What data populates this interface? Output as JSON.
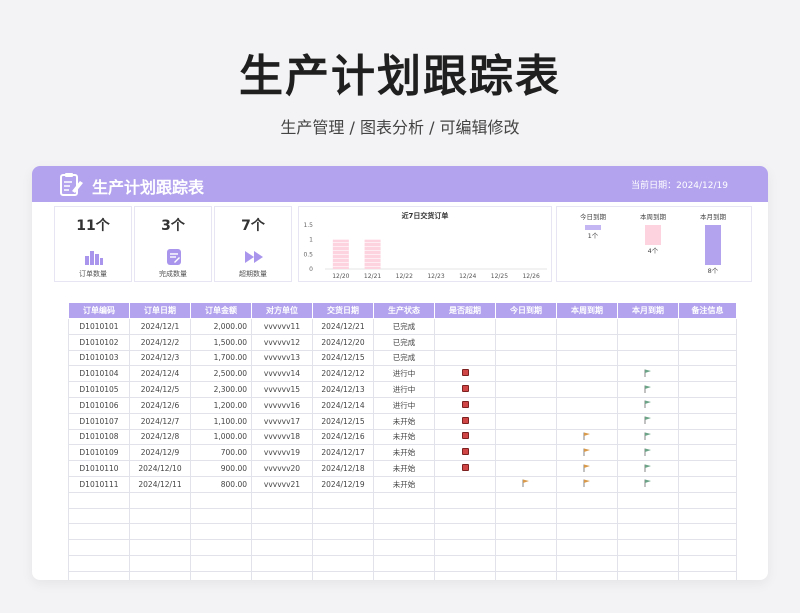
{
  "page": {
    "title": "生产计划跟踪表",
    "subtitle": "生产管理 / 图表分析 / 可编辑修改"
  },
  "header": {
    "title": "生产计划跟踪表",
    "date_label": "当前日期：",
    "date_value": "2024/12/19",
    "color": "#b3a3ee"
  },
  "stats": [
    {
      "value": "11个",
      "label": "订单数量",
      "icon": "bar-chart-icon"
    },
    {
      "value": "3个",
      "label": "完成数量",
      "icon": "document-edit-icon"
    },
    {
      "value": "7个",
      "label": "超期数量",
      "icon": "fast-forward-icon"
    }
  ],
  "chart_data": [
    {
      "type": "bar",
      "title": "近7日交货订单",
      "categories": [
        "12/20",
        "12/21",
        "12/22",
        "12/23",
        "12/24",
        "12/25",
        "12/26"
      ],
      "values": [
        1,
        1,
        0,
        0,
        0,
        0,
        0
      ],
      "ylim": [
        0,
        1.5
      ],
      "yticks": [
        "0",
        "0.5",
        "1",
        "1.5"
      ],
      "color": "#fcd3df"
    },
    {
      "type": "bar",
      "categories": [
        "今日到期",
        "本周到期",
        "本月到期"
      ],
      "values": [
        1,
        4,
        8
      ],
      "data_labels": [
        "1个",
        "4个",
        "8个"
      ],
      "colors": [
        "#c4b6f3",
        "#fcd3df",
        "#b3a3ee"
      ]
    }
  ],
  "table": {
    "headers": [
      "订单编码",
      "订单日期",
      "订单金额",
      "对方单位",
      "交货日期",
      "生产状态",
      "是否超期",
      "今日到期",
      "本周到期",
      "本月到期",
      "备注信息"
    ],
    "rows": [
      {
        "code": "D1010101",
        "date": "2024/12/1",
        "amount": "2,000.00",
        "unit": "vvvvvv11",
        "delivery": "2024/12/21",
        "status": "已完成",
        "overdue": false,
        "today": false,
        "week": false,
        "month": false
      },
      {
        "code": "D1010102",
        "date": "2024/12/2",
        "amount": "1,500.00",
        "unit": "vvvvvv12",
        "delivery": "2024/12/20",
        "status": "已完成",
        "overdue": false,
        "today": false,
        "week": false,
        "month": false
      },
      {
        "code": "D1010103",
        "date": "2024/12/3",
        "amount": "1,700.00",
        "unit": "vvvvvv13",
        "delivery": "2024/12/15",
        "status": "已完成",
        "overdue": false,
        "today": false,
        "week": false,
        "month": false
      },
      {
        "code": "D1010104",
        "date": "2024/12/4",
        "amount": "2,500.00",
        "unit": "vvvvvv14",
        "delivery": "2024/12/12",
        "status": "进行中",
        "overdue": true,
        "today": false,
        "week": false,
        "month": true
      },
      {
        "code": "D1010105",
        "date": "2024/12/5",
        "amount": "2,300.00",
        "unit": "vvvvvv15",
        "delivery": "2024/12/13",
        "status": "进行中",
        "overdue": true,
        "today": false,
        "week": false,
        "month": true
      },
      {
        "code": "D1010106",
        "date": "2024/12/6",
        "amount": "1,200.00",
        "unit": "vvvvvv16",
        "delivery": "2024/12/14",
        "status": "进行中",
        "overdue": true,
        "today": false,
        "week": false,
        "month": true
      },
      {
        "code": "D1010107",
        "date": "2024/12/7",
        "amount": "1,100.00",
        "unit": "vvvvvv17",
        "delivery": "2024/12/15",
        "status": "未开始",
        "overdue": true,
        "today": false,
        "week": false,
        "month": true
      },
      {
        "code": "D1010108",
        "date": "2024/12/8",
        "amount": "1,000.00",
        "unit": "vvvvvv18",
        "delivery": "2024/12/16",
        "status": "未开始",
        "overdue": true,
        "today": false,
        "week": true,
        "month": true
      },
      {
        "code": "D1010109",
        "date": "2024/12/9",
        "amount": "700.00",
        "unit": "vvvvvv19",
        "delivery": "2024/12/17",
        "status": "未开始",
        "overdue": true,
        "today": false,
        "week": true,
        "month": true
      },
      {
        "code": "D1010110",
        "date": "2024/12/10",
        "amount": "900.00",
        "unit": "vvvvvv20",
        "delivery": "2024/12/18",
        "status": "未开始",
        "overdue": true,
        "today": false,
        "week": true,
        "month": true
      },
      {
        "code": "D1010111",
        "date": "2024/12/11",
        "amount": "800.00",
        "unit": "vvvvvv21",
        "delivery": "2024/12/19",
        "status": "未开始",
        "overdue": false,
        "today": true,
        "week": true,
        "month": true
      }
    ],
    "marker_colors": {
      "overdue": "#d04646",
      "today_week": "#d89a4a",
      "month": "#6aa386"
    }
  }
}
